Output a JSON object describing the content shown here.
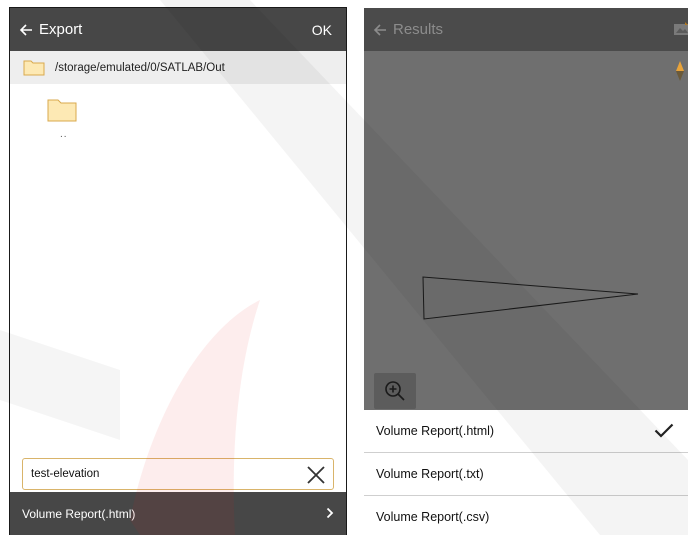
{
  "export_panel": {
    "title": "Export",
    "ok_label": "OK",
    "current_path": "/storage/emulated/0/SATLAB/Out",
    "parent_folder_label": "..",
    "filename_value": "test-elevation",
    "format_selected": "Volume Report(.html)"
  },
  "results_panel": {
    "title": "Results",
    "report_options": [
      {
        "label": "Volume Report(.html)",
        "selected": true
      },
      {
        "label": "Volume Report(.txt)",
        "selected": false
      },
      {
        "label": "Volume Report(.csv)",
        "selected": false
      }
    ]
  },
  "colors": {
    "toolbar": "#474747",
    "folder_fill": "#fde9b4",
    "folder_stroke": "#d9a94d",
    "input_border": "#d9b46a",
    "compass_orange": "#e8a33a"
  },
  "icons": [
    "back-arrow-icon",
    "folder-icon",
    "close-icon",
    "chevron-right-icon",
    "compass-icon",
    "zoom-in-icon",
    "checkmark-icon",
    "map-layer-icon"
  ]
}
